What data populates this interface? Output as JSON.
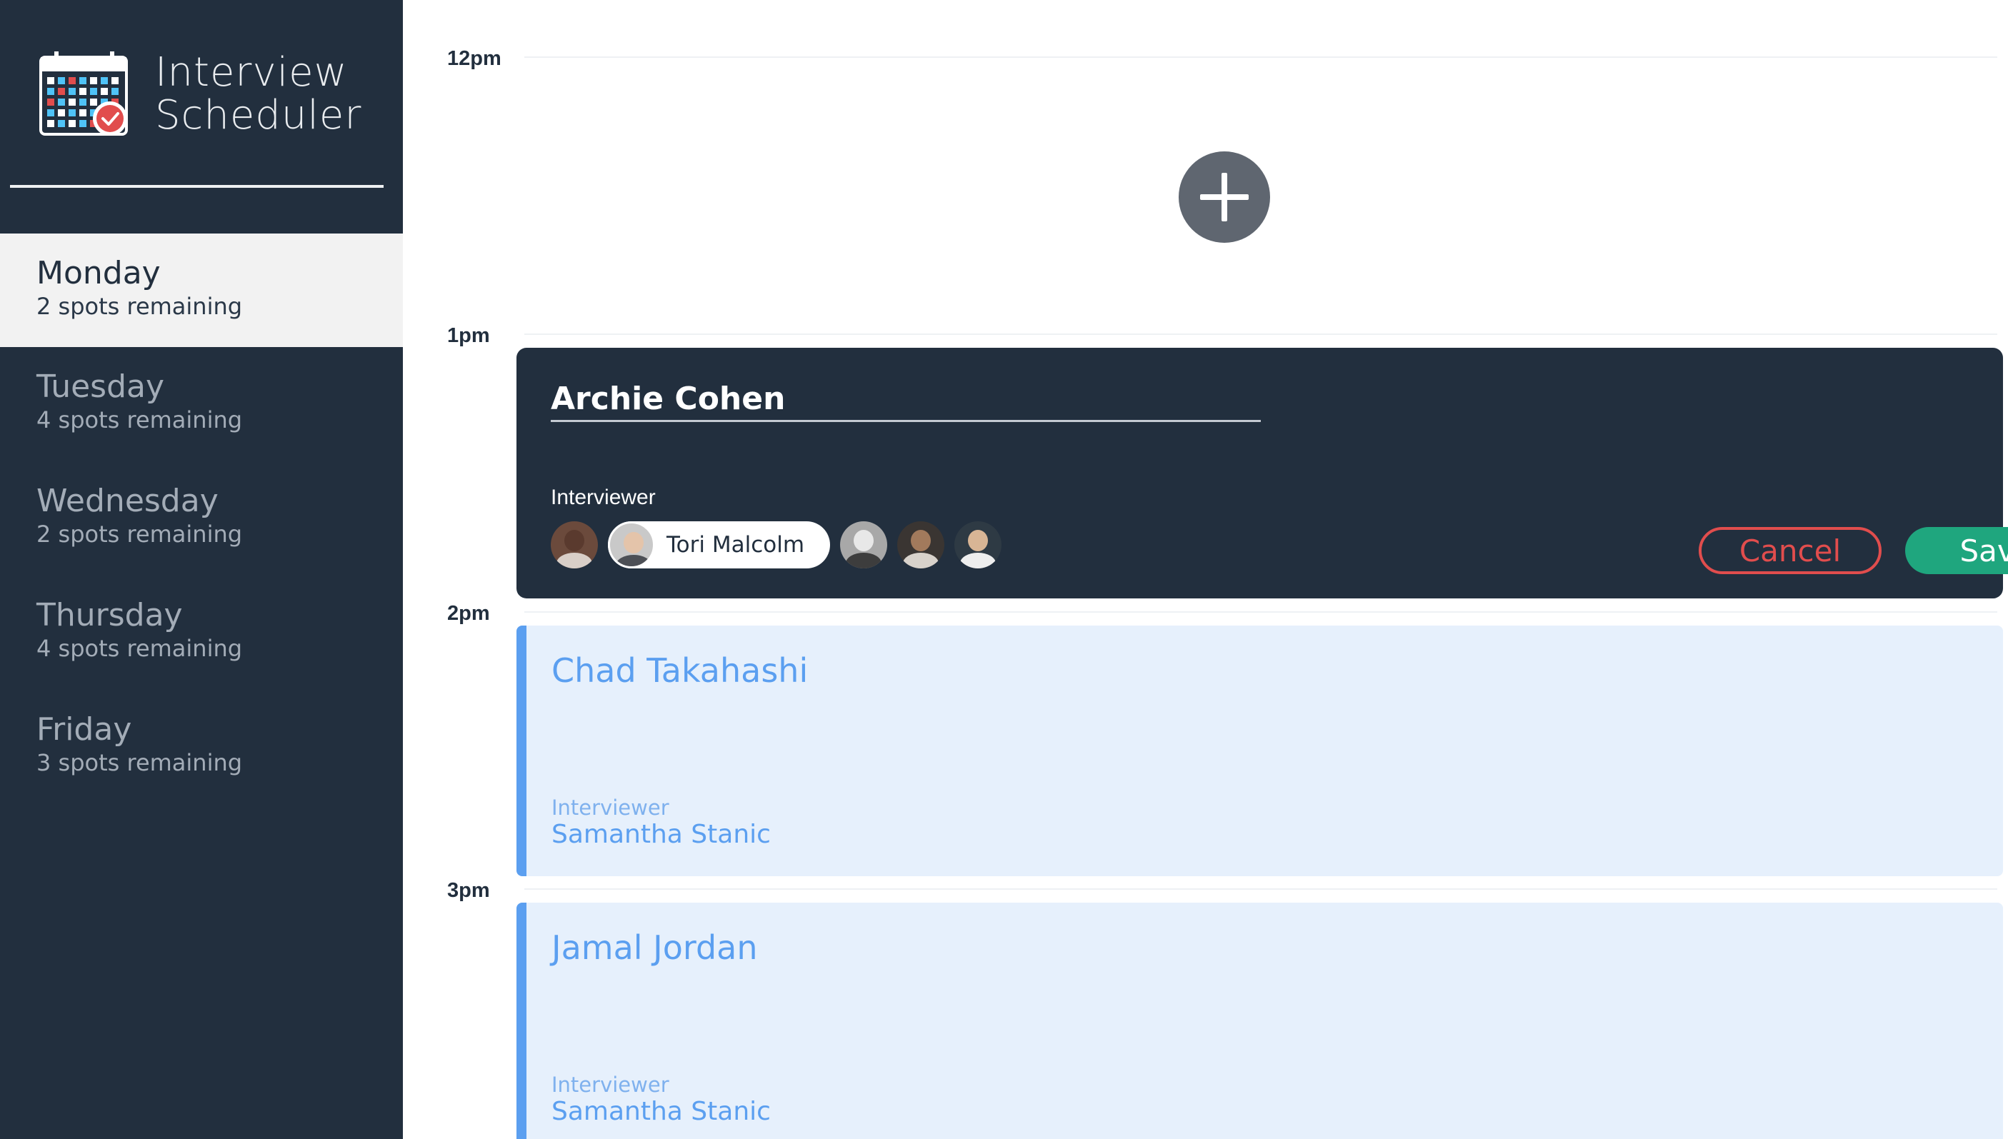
{
  "app": {
    "title_line1": "Interview",
    "title_line2": "Scheduler",
    "logo_icon": "calendar-check-icon"
  },
  "sidebar": {
    "days": [
      {
        "name": "Monday",
        "spots": "2 spots remaining",
        "selected": true
      },
      {
        "name": "Tuesday",
        "spots": "4 spots remaining",
        "selected": false
      },
      {
        "name": "Wednesday",
        "spots": "2 spots remaining",
        "selected": false
      },
      {
        "name": "Thursday",
        "spots": "4 spots remaining",
        "selected": false
      },
      {
        "name": "Friday",
        "spots": "3 spots remaining",
        "selected": false
      }
    ]
  },
  "schedule": {
    "time_slots": [
      "12pm",
      "1pm",
      "2pm",
      "3pm"
    ],
    "add_button_icon": "plus-icon",
    "edit_form": {
      "student_name": "Archie Cohen",
      "interviewer_heading": "Interviewer",
      "interviewers": [
        {
          "id": 1,
          "selected": false
        },
        {
          "id": 2,
          "name": "Tori Malcolm",
          "selected": true
        },
        {
          "id": 3,
          "selected": false
        },
        {
          "id": 4,
          "selected": false
        },
        {
          "id": 5,
          "selected": false
        }
      ],
      "cancel_label": "Cancel",
      "save_label": "Save"
    },
    "appointments": [
      {
        "student": "Chad Takahashi",
        "interviewer_heading": "Interviewer",
        "interviewer": "Samantha Stanic"
      },
      {
        "student": "Jamal Jordan",
        "interviewer_heading": "Interviewer",
        "interviewer": "Samantha Stanic"
      }
    ]
  },
  "colors": {
    "sidebar_bg": "#222f3e",
    "selected_day_bg": "#f2f2f2",
    "cancel": "#e14d4d",
    "save": "#1fa67e",
    "appointment_accent": "#5b9ff0",
    "appointment_bg": "#e6f0fc",
    "add_button": "#5f6670"
  }
}
